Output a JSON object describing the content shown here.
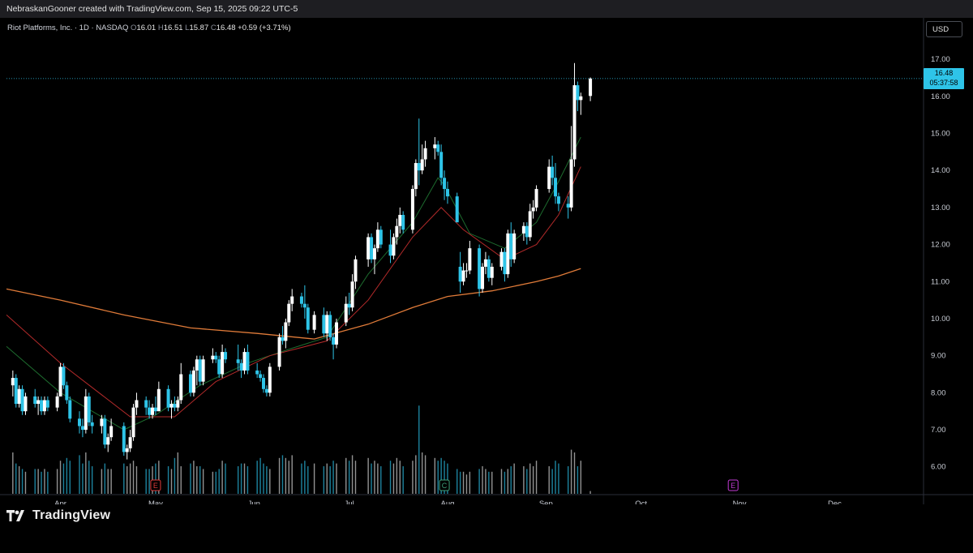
{
  "window": {
    "title": "NebraskanGooner created with TradingView.com, Sep 15, 2025 09:22 UTC-5"
  },
  "legend": {
    "symbol": "Riot Platforms, Inc. · 1D · NASDAQ",
    "o_label": "O",
    "o": "16.01",
    "h_label": "H",
    "h": "16.51",
    "l_label": "L",
    "l": "15.87",
    "c_label": "C",
    "c": "16.48",
    "change": "+0.59 (+3.71%)"
  },
  "currency_button": "USD",
  "price_tag": {
    "price": "16.48",
    "countdown": "05:37:58"
  },
  "brand": {
    "name": "TradingView",
    "icon": "tradingview-logo-icon"
  },
  "colors": {
    "background": "#000000",
    "up_candle": "#ffffff",
    "down_candle": "#2ec4e8",
    "ema_short": "#1d6b2e",
    "ema_mid": "#b22a2a",
    "ma_long": "#e07b39",
    "earnings_past": "#e03a3a",
    "earnings_future": "#c23bd4",
    "event_marker": "#3fa07a"
  },
  "chart_data": {
    "type": "candlestick",
    "title": "",
    "xlabel": "",
    "ylabel": "",
    "y_ticks": [
      "6.00",
      "7.00",
      "8.00",
      "9.00",
      "10.00",
      "11.00",
      "12.00",
      "13.00",
      "14.00",
      "15.00",
      "16.00",
      "17.00"
    ],
    "x_ticks": [
      "Apr",
      "May",
      "Jun",
      "Jul",
      "Aug",
      "Sep",
      "Oct",
      "Nov",
      "Dec"
    ],
    "ylim": [
      5.25,
      17.55
    ],
    "x_range": [
      "2025-03-15",
      "2025-12-29"
    ],
    "last_price": 16.48,
    "grid": false,
    "earnings_markers": [
      {
        "date": "2025-05-01",
        "label": "E",
        "kind": "past"
      },
      {
        "date": "2025-07-31",
        "label": "C",
        "kind": "event"
      },
      {
        "date": "2025-10-30",
        "label": "E",
        "kind": "future"
      }
    ],
    "moving_averages": [
      {
        "name": "ema_short",
        "points": [
          [
            "2025-03-15",
            9.25
          ],
          [
            "2025-04-01",
            8.0
          ],
          [
            "2025-04-21",
            7.0
          ],
          [
            "2025-05-01",
            7.4
          ],
          [
            "2025-05-15",
            8.2
          ],
          [
            "2025-05-30",
            8.8
          ],
          [
            "2025-06-13",
            9.2
          ],
          [
            "2025-06-24",
            9.5
          ],
          [
            "2025-07-07",
            11.2
          ],
          [
            "2025-07-21",
            12.6
          ],
          [
            "2025-07-29",
            13.8
          ],
          [
            "2025-07-31",
            13.6
          ],
          [
            "2025-08-08",
            12.3
          ],
          [
            "2025-08-19",
            11.9
          ],
          [
            "2025-08-29",
            12.6
          ],
          [
            "2025-09-05",
            13.7
          ],
          [
            "2025-09-12",
            14.9
          ]
        ]
      },
      {
        "name": "ema_mid",
        "points": [
          [
            "2025-03-15",
            10.1
          ],
          [
            "2025-04-01",
            8.8
          ],
          [
            "2025-04-23",
            7.35
          ],
          [
            "2025-05-07",
            7.35
          ],
          [
            "2025-05-20",
            8.3
          ],
          [
            "2025-06-06",
            9.0
          ],
          [
            "2025-06-24",
            9.4
          ],
          [
            "2025-07-07",
            10.5
          ],
          [
            "2025-07-21",
            12.2
          ],
          [
            "2025-07-30",
            13.0
          ],
          [
            "2025-08-06",
            12.4
          ],
          [
            "2025-08-19",
            11.6
          ],
          [
            "2025-08-29",
            12.0
          ],
          [
            "2025-09-05",
            12.8
          ],
          [
            "2025-09-12",
            14.1
          ]
        ]
      },
      {
        "name": "ma_long",
        "points": [
          [
            "2025-03-15",
            10.8
          ],
          [
            "2025-04-01",
            10.5
          ],
          [
            "2025-04-21",
            10.1
          ],
          [
            "2025-05-12",
            9.75
          ],
          [
            "2025-06-02",
            9.6
          ],
          [
            "2025-06-20",
            9.45
          ],
          [
            "2025-07-07",
            9.85
          ],
          [
            "2025-07-21",
            10.3
          ],
          [
            "2025-08-01",
            10.6
          ],
          [
            "2025-08-15",
            10.75
          ],
          [
            "2025-08-29",
            11.0
          ],
          [
            "2025-09-05",
            11.15
          ],
          [
            "2025-09-12",
            11.35
          ]
        ]
      }
    ],
    "candles": [
      [
        "2025-03-17",
        8.2,
        8.6,
        7.9,
        8.4,
        1.5
      ],
      [
        "2025-03-18",
        8.4,
        8.5,
        7.6,
        7.7,
        1.1
      ],
      [
        "2025-03-19",
        7.7,
        8.2,
        7.6,
        8.1,
        1.0
      ],
      [
        "2025-03-20",
        8.1,
        8.2,
        7.4,
        7.5,
        0.9
      ],
      [
        "2025-03-21",
        7.5,
        8.0,
        7.4,
        7.9,
        0.8
      ],
      [
        "2025-03-24",
        7.9,
        8.1,
        7.6,
        7.7,
        0.9
      ],
      [
        "2025-03-25",
        7.7,
        7.9,
        7.4,
        7.8,
        0.9
      ],
      [
        "2025-03-26",
        7.8,
        7.9,
        7.4,
        7.5,
        0.8
      ],
      [
        "2025-03-27",
        7.5,
        7.9,
        7.4,
        7.8,
        0.9
      ],
      [
        "2025-03-28",
        7.8,
        7.9,
        7.5,
        7.6,
        0.8
      ],
      [
        "2025-03-31",
        7.6,
        8.0,
        7.5,
        7.9,
        0.9
      ],
      [
        "2025-04-01",
        7.9,
        8.8,
        7.9,
        8.7,
        1.2
      ],
      [
        "2025-04-02",
        8.7,
        8.8,
        8.1,
        8.2,
        1.1
      ],
      [
        "2025-04-03",
        8.2,
        8.3,
        7.7,
        7.8,
        1.3
      ],
      [
        "2025-04-04",
        7.8,
        7.9,
        7.2,
        7.3,
        1.2
      ],
      [
        "2025-04-07",
        7.3,
        7.5,
        6.9,
        7.1,
        1.4
      ],
      [
        "2025-04-08",
        7.1,
        7.3,
        6.8,
        7.0,
        1.1
      ],
      [
        "2025-04-09",
        7.0,
        8.1,
        6.9,
        7.9,
        1.5
      ],
      [
        "2025-04-10",
        7.9,
        8.0,
        7.1,
        7.2,
        1.2
      ],
      [
        "2025-04-11",
        7.2,
        7.4,
        6.9,
        7.1,
        1.0
      ],
      [
        "2025-04-14",
        7.1,
        7.4,
        6.9,
        7.3,
        0.9
      ],
      [
        "2025-04-15",
        7.3,
        7.4,
        6.5,
        6.6,
        1.1
      ],
      [
        "2025-04-16",
        6.6,
        6.9,
        6.4,
        6.8,
        0.9
      ],
      [
        "2025-04-17",
        6.8,
        7.3,
        6.7,
        7.1,
        0.9
      ],
      [
        "2025-04-21",
        7.1,
        7.2,
        6.3,
        6.4,
        1.1
      ],
      [
        "2025-04-22",
        6.4,
        6.6,
        6.2,
        6.5,
        1.0
      ],
      [
        "2025-04-23",
        6.5,
        7.0,
        6.4,
        6.8,
        1.1
      ],
      [
        "2025-04-24",
        6.8,
        7.7,
        6.7,
        7.6,
        1.2
      ],
      [
        "2025-04-25",
        7.6,
        8.0,
        7.4,
        7.8,
        1.0
      ],
      [
        "2025-04-28",
        7.8,
        7.9,
        7.4,
        7.6,
        0.9
      ],
      [
        "2025-04-29",
        7.6,
        7.8,
        7.3,
        7.4,
        0.9
      ],
      [
        "2025-04-30",
        7.4,
        7.7,
        7.3,
        7.6,
        1.0
      ],
      [
        "2025-05-01",
        7.6,
        7.9,
        7.4,
        7.5,
        1.1
      ],
      [
        "2025-05-02",
        7.5,
        8.3,
        7.5,
        8.1,
        1.2
      ],
      [
        "2025-05-05",
        8.1,
        8.2,
        7.5,
        7.6,
        1.0
      ],
      [
        "2025-05-06",
        7.6,
        7.8,
        7.3,
        7.7,
        0.9
      ],
      [
        "2025-05-07",
        7.7,
        7.9,
        7.5,
        7.6,
        1.3
      ],
      [
        "2025-05-08",
        7.6,
        7.9,
        7.5,
        7.8,
        1.5
      ],
      [
        "2025-05-09",
        7.8,
        8.8,
        7.7,
        8.5,
        1.0
      ],
      [
        "2025-05-12",
        8.5,
        8.6,
        7.9,
        8.0,
        1.1
      ],
      [
        "2025-05-13",
        8.0,
        8.7,
        7.9,
        8.6,
        1.2
      ],
      [
        "2025-05-14",
        8.6,
        9.0,
        8.2,
        8.9,
        1.0
      ],
      [
        "2025-05-15",
        8.9,
        9.0,
        8.2,
        8.3,
        1.0
      ],
      [
        "2025-05-16",
        8.3,
        9.0,
        8.2,
        8.9,
        0.9
      ],
      [
        "2025-05-19",
        8.9,
        9.2,
        8.8,
        9.0,
        0.8
      ],
      [
        "2025-05-20",
        9.0,
        9.1,
        8.8,
        8.9,
        0.8
      ],
      [
        "2025-05-21",
        8.9,
        9.0,
        8.4,
        8.5,
        0.9
      ],
      [
        "2025-05-22",
        8.5,
        9.3,
        8.4,
        9.1,
        1.2
      ],
      [
        "2025-05-23",
        9.1,
        9.2,
        8.8,
        8.9,
        1.1
      ],
      [
        "2025-05-27",
        8.9,
        9.3,
        8.6,
        8.8,
        1.0
      ],
      [
        "2025-05-28",
        8.8,
        8.9,
        8.4,
        8.6,
        1.1
      ],
      [
        "2025-05-29",
        8.6,
        9.2,
        8.5,
        9.1,
        1.1
      ],
      [
        "2025-05-30",
        9.1,
        9.3,
        8.5,
        8.6,
        1.0
      ],
      [
        "2025-06-02",
        8.6,
        8.8,
        8.4,
        8.5,
        1.2
      ],
      [
        "2025-06-03",
        8.5,
        8.6,
        8.3,
        8.4,
        1.3
      ],
      [
        "2025-06-04",
        8.4,
        8.5,
        8.0,
        8.1,
        1.1
      ],
      [
        "2025-06-05",
        8.1,
        8.2,
        7.9,
        8.0,
        1.0
      ],
      [
        "2025-06-06",
        8.0,
        8.8,
        7.9,
        8.7,
        0.9
      ],
      [
        "2025-06-09",
        8.7,
        9.6,
        8.6,
        9.5,
        1.3
      ],
      [
        "2025-06-10",
        9.5,
        9.8,
        9.3,
        9.4,
        1.4
      ],
      [
        "2025-06-11",
        9.4,
        10.0,
        9.2,
        9.9,
        1.3
      ],
      [
        "2025-06-12",
        9.9,
        10.5,
        9.8,
        10.4,
        1.2
      ],
      [
        "2025-06-13",
        10.4,
        10.8,
        10.2,
        10.6,
        1.4
      ],
      [
        "2025-06-16",
        10.6,
        10.7,
        10.3,
        10.4,
        1.1
      ],
      [
        "2025-06-17",
        10.4,
        10.9,
        10.0,
        10.3,
        1.2
      ],
      [
        "2025-06-18",
        10.3,
        10.4,
        9.6,
        9.7,
        1.0
      ],
      [
        "2025-06-20",
        9.7,
        10.2,
        9.6,
        10.1,
        1.1
      ],
      [
        "2025-06-23",
        10.1,
        10.3,
        9.5,
        9.6,
        1.0
      ],
      [
        "2025-06-24",
        9.6,
        10.2,
        9.4,
        10.1,
        1.1
      ],
      [
        "2025-06-25",
        10.1,
        10.2,
        9.4,
        9.5,
        1.0
      ],
      [
        "2025-06-26",
        9.5,
        9.6,
        8.9,
        9.3,
        1.2
      ],
      [
        "2025-06-27",
        9.3,
        10.0,
        9.2,
        9.9,
        1.1
      ],
      [
        "2025-06-30",
        9.9,
        10.6,
        9.8,
        10.4,
        1.3
      ],
      [
        "2025-07-01",
        10.4,
        10.7,
        10.1,
        10.3,
        1.2
      ],
      [
        "2025-07-02",
        10.3,
        11.2,
        10.2,
        11.0,
        1.4
      ],
      [
        "2025-07-03",
        11.0,
        11.7,
        10.8,
        11.6,
        1.2
      ],
      [
        "2025-07-07",
        11.6,
        12.3,
        11.4,
        12.2,
        1.3
      ],
      [
        "2025-07-08",
        12.2,
        12.3,
        11.5,
        11.6,
        1.1
      ],
      [
        "2025-07-09",
        11.6,
        12.0,
        11.2,
        11.9,
        1.2
      ],
      [
        "2025-07-10",
        11.9,
        12.6,
        11.8,
        12.4,
        1.1
      ],
      [
        "2025-07-11",
        12.4,
        12.5,
        11.9,
        12.0,
        1.0
      ],
      [
        "2025-07-14",
        12.0,
        12.4,
        11.5,
        11.7,
        1.2
      ],
      [
        "2025-07-15",
        11.7,
        12.3,
        11.6,
        12.2,
        1.1
      ],
      [
        "2025-07-16",
        12.2,
        12.7,
        12.0,
        12.5,
        1.3
      ],
      [
        "2025-07-17",
        12.5,
        13.0,
        12.3,
        12.8,
        1.2
      ],
      [
        "2025-07-18",
        12.8,
        12.9,
        12.3,
        12.4,
        1.0
      ],
      [
        "2025-07-21",
        12.4,
        13.6,
        12.3,
        13.5,
        1.2
      ],
      [
        "2025-07-22",
        13.5,
        14.3,
        13.3,
        14.2,
        1.4
      ],
      [
        "2025-07-23",
        14.2,
        15.4,
        13.6,
        14.0,
        3.2
      ],
      [
        "2025-07-24",
        14.0,
        14.7,
        13.9,
        14.3,
        1.5
      ],
      [
        "2025-07-25",
        14.3,
        14.8,
        14.1,
        14.6,
        1.4
      ],
      [
        "2025-07-28",
        14.6,
        14.9,
        14.3,
        14.7,
        1.3
      ],
      [
        "2025-07-29",
        14.7,
        14.8,
        14.4,
        14.5,
        1.2
      ],
      [
        "2025-07-30",
        14.5,
        14.7,
        13.6,
        13.8,
        1.3
      ],
      [
        "2025-07-31",
        13.8,
        14.0,
        13.2,
        13.5,
        1.2
      ],
      [
        "2025-08-01",
        13.5,
        13.7,
        13.1,
        13.3,
        1.1
      ],
      [
        "2025-08-04",
        13.3,
        13.4,
        12.6,
        12.6,
        0.9
      ],
      [
        "2025-08-05",
        11.4,
        11.8,
        10.7,
        11.0,
        0.8
      ],
      [
        "2025-08-06",
        11.0,
        11.5,
        10.9,
        11.3,
        0.8
      ],
      [
        "2025-08-07",
        11.3,
        11.5,
        11.1,
        11.3,
        0.7
      ],
      [
        "2025-08-08",
        11.3,
        12.1,
        11.2,
        11.9,
        0.8
      ],
      [
        "2025-08-11",
        11.9,
        12.0,
        10.6,
        10.8,
        0.9
      ],
      [
        "2025-08-12",
        10.8,
        11.5,
        10.7,
        11.4,
        1.0
      ],
      [
        "2025-08-13",
        11.4,
        11.8,
        11.2,
        11.6,
        0.9
      ],
      [
        "2025-08-14",
        11.6,
        11.7,
        11.0,
        11.1,
        0.8
      ],
      [
        "2025-08-15",
        11.1,
        11.5,
        10.9,
        11.4,
        0.8
      ],
      [
        "2025-08-18",
        11.4,
        11.9,
        11.3,
        11.8,
        0.9
      ],
      [
        "2025-08-19",
        11.8,
        11.9,
        11.0,
        11.2,
        0.8
      ],
      [
        "2025-08-20",
        11.2,
        12.4,
        11.1,
        12.3,
        0.9
      ],
      [
        "2025-08-21",
        12.3,
        12.6,
        11.4,
        11.6,
        1.0
      ],
      [
        "2025-08-22",
        11.6,
        12.4,
        11.5,
        12.3,
        1.1
      ],
      [
        "2025-08-25",
        12.3,
        12.6,
        12.1,
        12.5,
        1.0
      ],
      [
        "2025-08-26",
        12.5,
        12.6,
        12.0,
        12.2,
        0.9
      ],
      [
        "2025-08-27",
        12.2,
        13.1,
        12.1,
        12.9,
        1.1
      ],
      [
        "2025-08-28",
        12.9,
        13.2,
        12.7,
        13.0,
        1.0
      ],
      [
        "2025-08-29",
        13.0,
        13.6,
        12.9,
        13.5,
        1.2
      ],
      [
        "2025-09-02",
        13.5,
        14.3,
        13.4,
        14.1,
        1.0
      ],
      [
        "2025-09-03",
        14.1,
        14.4,
        13.6,
        13.8,
        0.9
      ],
      [
        "2025-09-04",
        13.8,
        14.2,
        13.1,
        13.3,
        1.2
      ],
      [
        "2025-09-05",
        13.3,
        13.4,
        12.9,
        13.1,
        1.1
      ],
      [
        "2025-09-08",
        13.1,
        13.3,
        12.7,
        13.0,
        1.0
      ],
      [
        "2025-09-09",
        13.0,
        15.2,
        12.9,
        14.3,
        1.6
      ],
      [
        "2025-09-10",
        14.3,
        16.9,
        14.1,
        16.3,
        1.5
      ],
      [
        "2025-09-11",
        16.3,
        16.4,
        15.6,
        15.9,
        1.0
      ],
      [
        "2025-09-12",
        15.9,
        16.1,
        15.5,
        16.0,
        1.2
      ],
      [
        "2025-09-15",
        16.01,
        16.51,
        15.87,
        16.48,
        0.1
      ]
    ]
  }
}
